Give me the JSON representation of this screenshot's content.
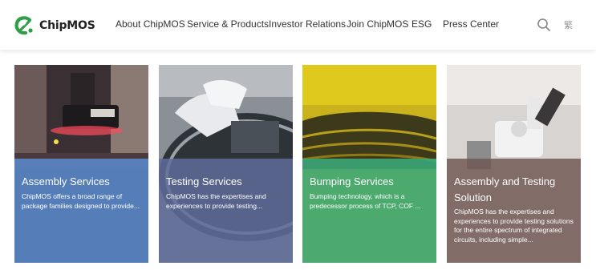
{
  "brand": {
    "name": "ChipMOS",
    "accent": "#2f9e46"
  },
  "nav": {
    "items": [
      {
        "label": "About ChipMOS"
      },
      {
        "label": "Service & Products"
      },
      {
        "label": "Investor Relations"
      },
      {
        "label": "Join ChipMOS"
      },
      {
        "label": "ESG"
      },
      {
        "label": "Press Center"
      }
    ],
    "search_icon": "search-icon",
    "language_label": "繁"
  },
  "cards": [
    {
      "title": "Assembly Services",
      "description": "ChipMOS offers a broad range of package families designed to provide...",
      "overlay_color": "#5b8fd6"
    },
    {
      "title": "Testing Services",
      "description": "ChipMOS has the expertises and experiences to provide testing...",
      "overlay_color": "#5f6d9a"
    },
    {
      "title": "Bumping Services",
      "description": "Bumping technology, which is a predecessor process of TCP, COF ...",
      "overlay_color": "#3aa87a"
    },
    {
      "title": "Assembly and Testing Solution",
      "description": "ChipMOS has the expertises and experiences to provide testing solutions for the entire spectrum of integrated circuits, including simple...",
      "overlay_color": "#7a5a52"
    }
  ]
}
